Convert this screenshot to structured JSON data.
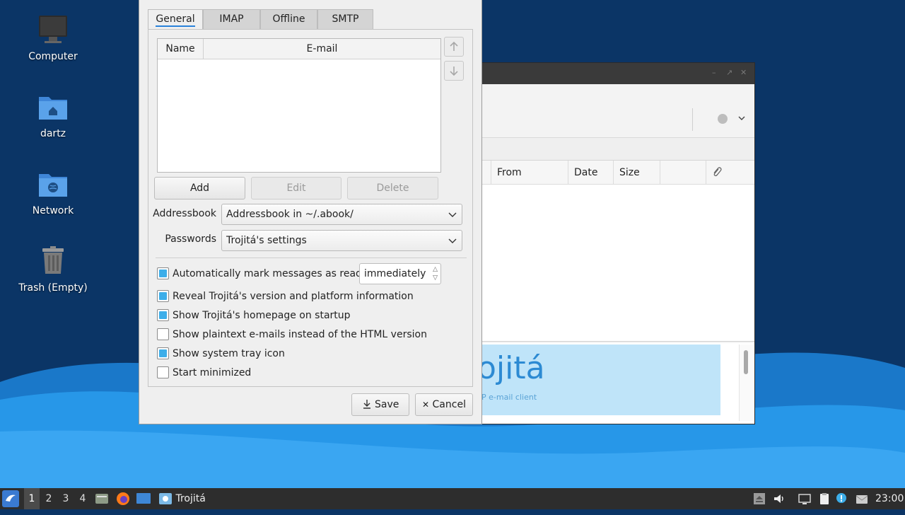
{
  "desktop": {
    "icons": [
      {
        "label": "Computer",
        "icon": "computer-icon"
      },
      {
        "label": "dartz",
        "icon": "home-folder-icon"
      },
      {
        "label": "Network",
        "icon": "network-folder-icon"
      },
      {
        "label": "Trash (Empty)",
        "icon": "trash-icon"
      }
    ]
  },
  "main_window": {
    "columns": [
      "From",
      "Date",
      "Size"
    ],
    "attachment_column_icon": "paperclip-icon",
    "preview": {
      "logo_text": "ojitá",
      "tagline": "P e-mail client"
    }
  },
  "dialog": {
    "tabs": [
      {
        "label": "General",
        "active": true
      },
      {
        "label": "IMAP",
        "active": false
      },
      {
        "label": "Offline",
        "active": false
      },
      {
        "label": "SMTP",
        "active": false
      }
    ],
    "identities_table": {
      "headers": [
        "Name",
        "E-mail"
      ],
      "rows": []
    },
    "buttons": {
      "add": "Add",
      "edit": "Edit",
      "delete": "Delete",
      "save": "Save",
      "cancel": "Cancel"
    },
    "addressbook": {
      "label": "Addressbook",
      "value": "Addressbook in ~/.abook/"
    },
    "passwords": {
      "label": "Passwords",
      "value": "Trojitá's settings"
    },
    "mark_read": {
      "label": "Automatically mark messages as read",
      "checked": true,
      "when": "immediately"
    },
    "options": [
      {
        "label": "Reveal Trojitá's version and platform information",
        "checked": true
      },
      {
        "label": "Show Trojitá's homepage on startup",
        "checked": true
      },
      {
        "label": "Show plaintext e-mails instead of the HTML version",
        "checked": false
      },
      {
        "label": "Show system tray icon",
        "checked": true
      },
      {
        "label": "Start minimized",
        "checked": false
      }
    ]
  },
  "taskbar": {
    "workspaces": [
      "1",
      "2",
      "3",
      "4"
    ],
    "active_workspace": "1",
    "window_button": "Trojitá",
    "clock": "23:00"
  },
  "colors": {
    "accent": "#3daee9",
    "desktop": "#0b3566",
    "taskbar": "#2d2d2d"
  }
}
